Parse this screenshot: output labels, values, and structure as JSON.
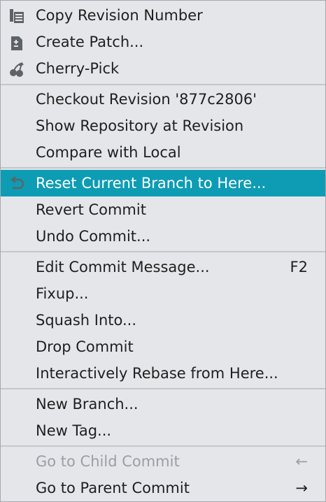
{
  "menu": {
    "items": [
      {
        "label": "Copy Revision Number",
        "icon": "copy-icon"
      },
      {
        "label": "Create Patch...",
        "icon": "patch-file-icon"
      },
      {
        "label": "Cherry-Pick",
        "icon": "cherry-icon"
      },
      {
        "label": "Checkout Revision '877c2806'"
      },
      {
        "label": "Show Repository at Revision"
      },
      {
        "label": "Compare with Local"
      },
      {
        "label": "Reset Current Branch to Here...",
        "icon": "undo-arrow-icon",
        "selected": true
      },
      {
        "label": "Revert Commit"
      },
      {
        "label": "Undo Commit..."
      },
      {
        "label": "Edit Commit Message...",
        "shortcut": "F2"
      },
      {
        "label": "Fixup..."
      },
      {
        "label": "Squash Into..."
      },
      {
        "label": "Drop Commit"
      },
      {
        "label": "Interactively Rebase from Here..."
      },
      {
        "label": "New Branch..."
      },
      {
        "label": "New Tag..."
      },
      {
        "label": "Go to Child Commit",
        "shortcut": "←",
        "disabled": true
      },
      {
        "label": "Go to Parent Commit",
        "shortcut": "→"
      }
    ]
  },
  "colors": {
    "selection": "#0d9cb4",
    "menu_background": "#e4e6ea",
    "separator": "#c4c6ca",
    "disabled_text": "#9b9ea4",
    "icon_gray": "#5f6368"
  }
}
